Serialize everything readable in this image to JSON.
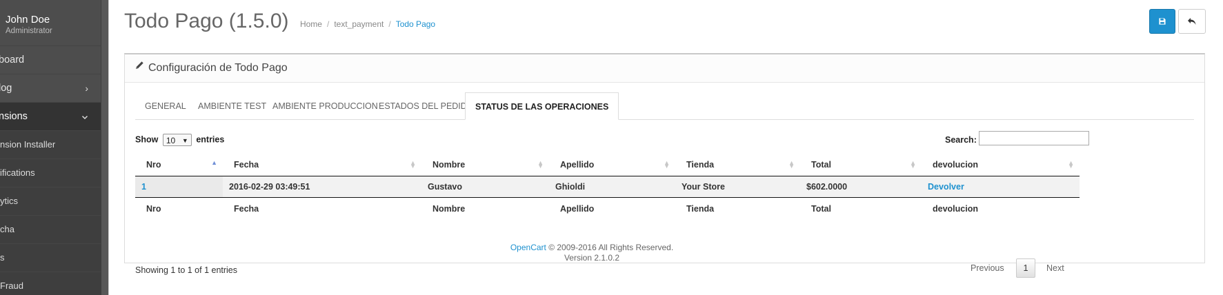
{
  "user": {
    "name": "John Doe",
    "role": "Administrator"
  },
  "sidebar": {
    "items": [
      {
        "label": "board"
      },
      {
        "label": "log"
      },
      {
        "label": "nsions"
      }
    ],
    "subitems": [
      {
        "label": "nsion Installer"
      },
      {
        "label": "ifications"
      },
      {
        "label": "ytics"
      },
      {
        "label": "cha"
      },
      {
        "label": "s"
      },
      {
        "label": "Fraud"
      }
    ]
  },
  "header": {
    "title": "Todo Pago (1.5.0)",
    "breadcrumb": [
      "Home",
      "text_payment",
      "Todo Pago"
    ]
  },
  "panel": {
    "title": "Configuración de Todo Pago"
  },
  "tabs": [
    {
      "label": "GENERAL"
    },
    {
      "label": "AMBIENTE TEST"
    },
    {
      "label": "AMBIENTE PRODUCCION"
    },
    {
      "label": "ESTADOS DEL PEDIDO"
    },
    {
      "label": "STATUS DE LAS OPERACIONES"
    }
  ],
  "datatable": {
    "show_label": "Show",
    "entries_label": "entries",
    "page_length": "10",
    "search_label": "Search:",
    "search_value": "",
    "columns": [
      "Nro",
      "Fecha",
      "Nombre",
      "Apellido",
      "Tienda",
      "Total",
      "devolucion"
    ],
    "rows": [
      {
        "nro": "1",
        "fecha": "2016-02-29 03:49:51",
        "nombre": "Gustavo",
        "apellido": "Ghioldi",
        "tienda": "Your Store",
        "total": "$602.0000",
        "devolucion": "Devolver"
      }
    ],
    "info": "Showing 1 to 1 of 1 entries",
    "pagination": {
      "previous": "Previous",
      "current": "1",
      "next": "Next"
    }
  },
  "footer": {
    "brand": "OpenCart",
    "copyright": " © 2009-2016 All Rights Reserved.",
    "version": "Version 2.1.0.2"
  },
  "colors": {
    "primary": "#1e91cf",
    "sidebar_bg": "#4d4d4d"
  },
  "icons": {
    "save": "save-icon",
    "back": "reply-icon",
    "panel": "pencil-icon",
    "expand": "chevron-icon"
  }
}
